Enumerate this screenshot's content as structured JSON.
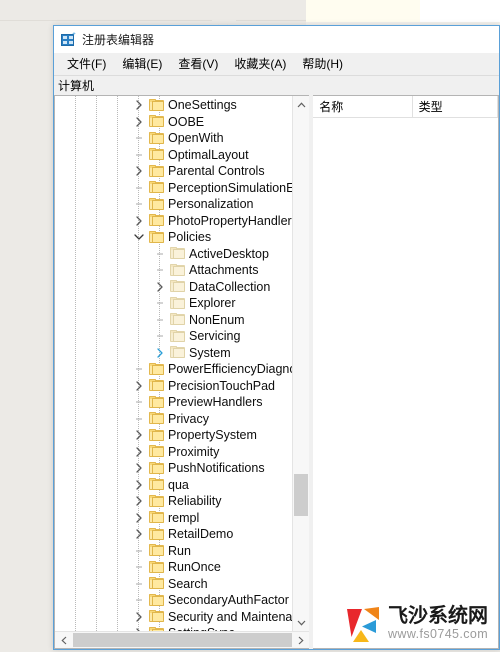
{
  "window": {
    "title": "注册表编辑器",
    "icon": "registry-editor-icon"
  },
  "menubar": {
    "items": [
      {
        "label": "文件(F)",
        "name": "menu-file"
      },
      {
        "label": "编辑(E)",
        "name": "menu-edit"
      },
      {
        "label": "查看(V)",
        "name": "menu-view"
      },
      {
        "label": "收藏夹(A)",
        "name": "menu-favorites"
      },
      {
        "label": "帮助(H)",
        "name": "menu-help"
      }
    ]
  },
  "address": {
    "value": "计算机"
  },
  "tree": {
    "nodes": [
      {
        "label": "OneSettings",
        "depth": 4,
        "state": "collapsed",
        "dim": false
      },
      {
        "label": "OOBE",
        "depth": 4,
        "state": "collapsed",
        "dim": false
      },
      {
        "label": "OpenWith",
        "depth": 4,
        "state": "leaf",
        "dim": false
      },
      {
        "label": "OptimalLayout",
        "depth": 4,
        "state": "leaf",
        "dim": false
      },
      {
        "label": "Parental Controls",
        "depth": 4,
        "state": "collapsed",
        "dim": false
      },
      {
        "label": "PerceptionSimulationExtens",
        "depth": 4,
        "state": "leaf",
        "dim": false
      },
      {
        "label": "Personalization",
        "depth": 4,
        "state": "leaf",
        "dim": false
      },
      {
        "label": "PhotoPropertyHandler",
        "depth": 4,
        "state": "collapsed",
        "dim": false
      },
      {
        "label": "Policies",
        "depth": 4,
        "state": "expanded",
        "dim": false
      },
      {
        "label": "ActiveDesktop",
        "depth": 5,
        "state": "leaf",
        "dim": true
      },
      {
        "label": "Attachments",
        "depth": 5,
        "state": "leaf",
        "dim": true
      },
      {
        "label": "DataCollection",
        "depth": 5,
        "state": "collapsed",
        "dim": true
      },
      {
        "label": "Explorer",
        "depth": 5,
        "state": "leaf",
        "dim": true
      },
      {
        "label": "NonEnum",
        "depth": 5,
        "state": "leaf",
        "dim": true
      },
      {
        "label": "Servicing",
        "depth": 5,
        "state": "leaf",
        "dim": true
      },
      {
        "label": "System",
        "depth": 5,
        "state": "collapsed-selected",
        "dim": true
      },
      {
        "label": "PowerEfficiencyDiagnostics",
        "depth": 4,
        "state": "leaf",
        "dim": false
      },
      {
        "label": "PrecisionTouchPad",
        "depth": 4,
        "state": "collapsed",
        "dim": false
      },
      {
        "label": "PreviewHandlers",
        "depth": 4,
        "state": "leaf",
        "dim": false
      },
      {
        "label": "Privacy",
        "depth": 4,
        "state": "leaf",
        "dim": false
      },
      {
        "label": "PropertySystem",
        "depth": 4,
        "state": "collapsed",
        "dim": false
      },
      {
        "label": "Proximity",
        "depth": 4,
        "state": "collapsed",
        "dim": false
      },
      {
        "label": "PushNotifications",
        "depth": 4,
        "state": "collapsed",
        "dim": false
      },
      {
        "label": "qua",
        "depth": 4,
        "state": "collapsed",
        "dim": false
      },
      {
        "label": "Reliability",
        "depth": 4,
        "state": "collapsed",
        "dim": false
      },
      {
        "label": "rempl",
        "depth": 4,
        "state": "collapsed",
        "dim": false
      },
      {
        "label": "RetailDemo",
        "depth": 4,
        "state": "collapsed",
        "dim": false
      },
      {
        "label": "Run",
        "depth": 4,
        "state": "leaf",
        "dim": false
      },
      {
        "label": "RunOnce",
        "depth": 4,
        "state": "leaf",
        "dim": false
      },
      {
        "label": "Search",
        "depth": 4,
        "state": "leaf",
        "dim": false
      },
      {
        "label": "SecondaryAuthFactor",
        "depth": 4,
        "state": "leaf",
        "dim": false
      },
      {
        "label": "Security and Maintenance",
        "depth": 4,
        "state": "collapsed",
        "dim": false
      },
      {
        "label": "SettingSync",
        "depth": 4,
        "state": "collapsed",
        "dim": false
      }
    ]
  },
  "list": {
    "columns": [
      {
        "label": "名称",
        "name": "column-header-name"
      },
      {
        "label": "类型",
        "name": "column-header-type"
      }
    ],
    "rows": []
  },
  "scrollbars": {
    "vertical_up": "▲",
    "vertical_down": "▼",
    "horizontal_left": "◀",
    "horizontal_right": "▶"
  },
  "watermark": {
    "title": "飞沙系统网",
    "url": "www.fs0745.com"
  }
}
